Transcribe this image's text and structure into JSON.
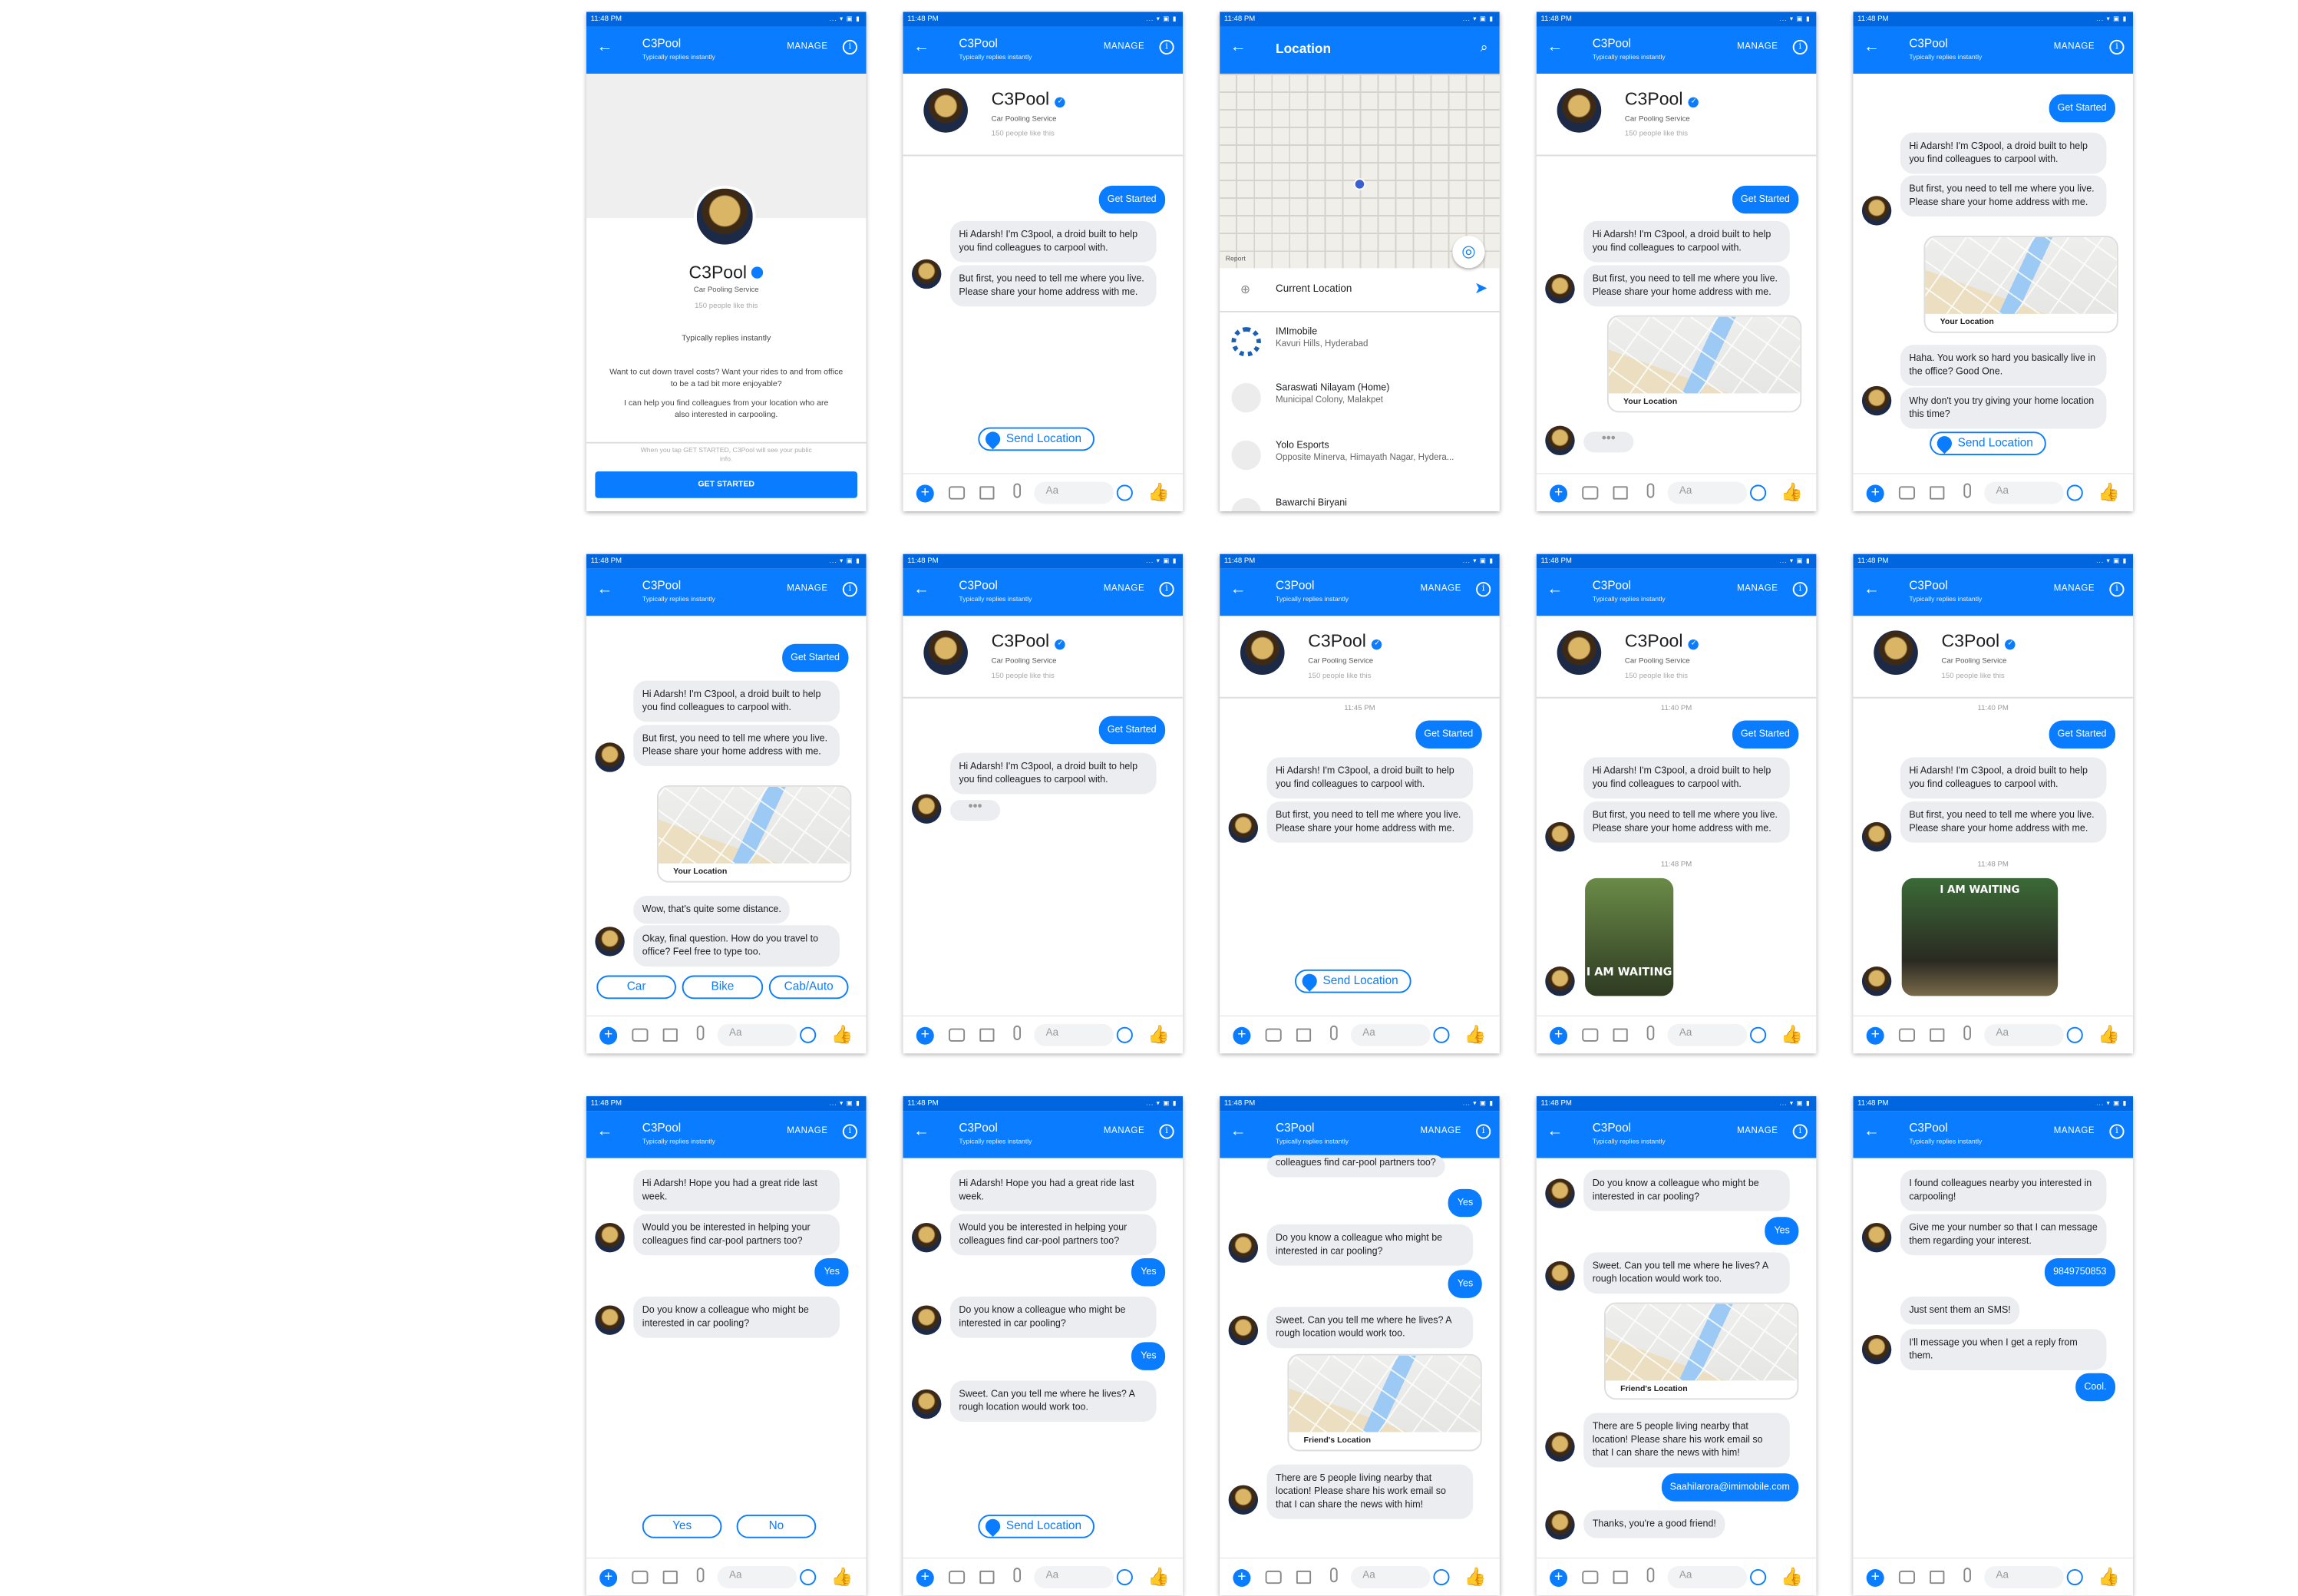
{
  "status": {
    "time": "11:48 PM",
    "icons": "... ▾ ▣ ▮"
  },
  "header": {
    "title": "C3Pool",
    "subtitle": "Typically replies instantly",
    "manage": "MANAGE",
    "info": "i",
    "back": "←",
    "location_title": "Location",
    "search": "⌕"
  },
  "profile": {
    "name": "C3Pool",
    "category": "Car Pooling Service",
    "likes": "150 people like this"
  },
  "intro": {
    "replies": "Typically replies instantly",
    "pitch": "Want to cut down travel costs? Want your rides to and from office to be a tad bit more enjoyable?",
    "help": "I can help you find colleagues from your location who are also interested in carpooling.",
    "notice": "When you tap GET STARTED, C3Pool will see your public info.",
    "button": "GET STARTED"
  },
  "composer": {
    "placeholder": "Aa",
    "plus": "+",
    "like": "👍"
  },
  "msgs": {
    "get_started": "Get Started",
    "hi": "Hi Adarsh! I'm C3pool, a droid built to help you find colleagues to carpool with.",
    "first": "But first, you need to tell me where you live. Please share your home address with me.",
    "your_location": "Your Location",
    "send_location": "Send Location",
    "haha": "Haha. You work so hard you basically live in the office? Good One.",
    "why": "Why don't you try giving your home location this time?",
    "wow": "Wow, that's quite some distance.",
    "okay": "Okay, final question. How do you travel to office? Feel free to type too.",
    "car": "Car",
    "bike": "Bike",
    "cab": "Cab/Auto",
    "ts1": "11:45 PM",
    "ts2": "11:40 PM",
    "ts3": "11:48 PM",
    "iamwaiting": "I AM WAITING",
    "hope": "Hi Adarsh! Hope you had a great ride last week.",
    "would": "Would you be interested in helping your colleagues find car-pool partners too?",
    "yes": "Yes",
    "no": "No",
    "doyou": "Do you know a colleague who might be interested in car pooling?",
    "sweet": "Sweet. Can you tell me where he lives? A rough location would work too.",
    "friends_location": "Friend's Location",
    "there": "There are 5 people living nearby that location! Please share his work email so that I can share the news with him!",
    "colleagues": "colleagues find car-pool partners too?",
    "email": "Saahilarora@imimobile.com",
    "thanks": "Thanks, you're a good friend!",
    "found": "I found colleagues nearby you interested in carpooling!",
    "give": "Give me your number so that I can message them regarding your interest.",
    "number": "9849750853",
    "sent": "Just sent them an SMS!",
    "illmsg": "I'll message you when I get a reply from them.",
    "cool": "Cool."
  },
  "location": {
    "report": "Report",
    "current": "Current Location",
    "places": [
      {
        "name": "IMImobile",
        "addr": "Kavuri Hills, Hyderabad"
      },
      {
        "name": "Saraswati Nilayam (Home)",
        "addr": "Municipal Colony, Malakpet"
      },
      {
        "name": "Yolo Esports",
        "addr": "Opposite Minerva, Himayath Nagar, Hydera..."
      },
      {
        "name": "Bawarchi Biryani",
        "addr": ""
      }
    ]
  }
}
